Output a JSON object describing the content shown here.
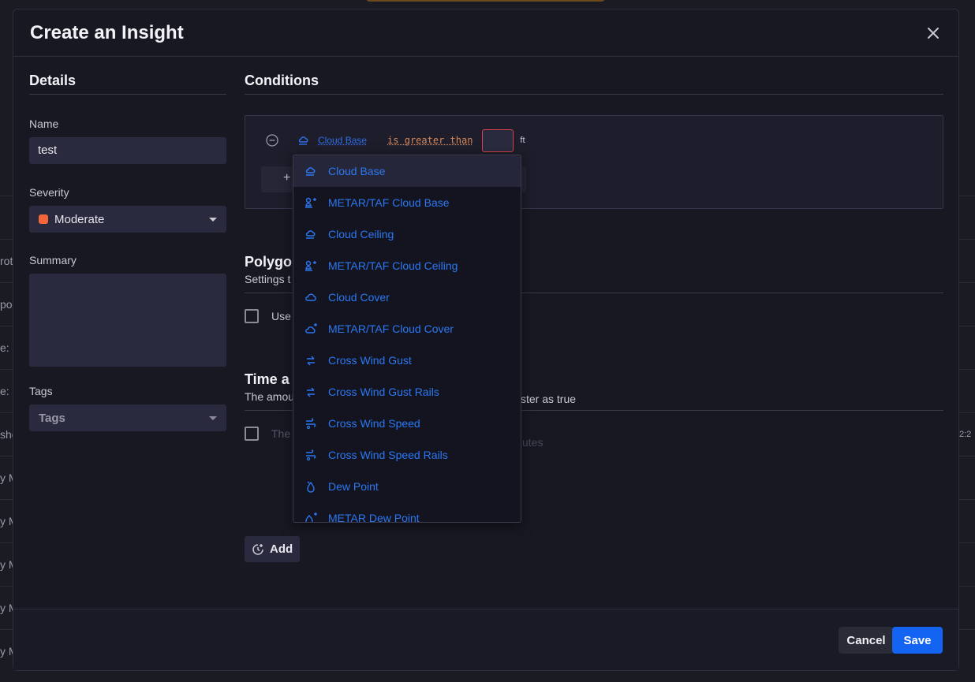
{
  "background": {
    "left_fragments": [
      "rot",
      "por",
      "e: ",
      "e: ",
      "sho",
      "y M",
      "y M",
      "y M",
      "y M",
      "y M"
    ],
    "right_fragment": "2:2"
  },
  "modal": {
    "title": "Create an Insight"
  },
  "details": {
    "title": "Details",
    "name_label": "Name",
    "name_value": "test",
    "severity_label": "Severity",
    "severity_value": "Moderate",
    "severity_color": "#f2663a",
    "summary_label": "Summary",
    "summary_value": "",
    "tags_label": "Tags",
    "tags_placeholder": "Tags"
  },
  "conditions": {
    "title": "Conditions",
    "metric": "Cloud Base",
    "operator": "is greater than",
    "value": "",
    "unit": "ft",
    "add_label": "+"
  },
  "polygon": {
    "title": "Polygo",
    "subtitle": "Settings t",
    "checkbox_label": "Use"
  },
  "time": {
    "title": "Time a",
    "subtitle_left": "The amou",
    "subtitle_right": "ster as true",
    "checkbox_label": "The",
    "dim_select": "utes",
    "add_label": "Add"
  },
  "dropdown": {
    "items": [
      {
        "label": "Cloud Base",
        "icon": "cloud-base-icon",
        "active": true
      },
      {
        "label": "METAR/TAF Cloud Base",
        "icon": "metar-cloud-base-icon"
      },
      {
        "label": "Cloud Ceiling",
        "icon": "cloud-ceiling-icon"
      },
      {
        "label": "METAR/TAF Cloud Ceiling",
        "icon": "metar-cloud-ceiling-icon"
      },
      {
        "label": "Cloud Cover",
        "icon": "cloud-cover-icon"
      },
      {
        "label": "METAR/TAF Cloud Cover",
        "icon": "metar-cloud-cover-icon"
      },
      {
        "label": "Cross Wind Gust",
        "icon": "cross-wind-icon"
      },
      {
        "label": "Cross Wind Gust Rails",
        "icon": "cross-wind-icon"
      },
      {
        "label": "Cross Wind Speed",
        "icon": "wind-speed-icon"
      },
      {
        "label": "Cross Wind Speed Rails",
        "icon": "wind-speed-icon"
      },
      {
        "label": "Dew Point",
        "icon": "dew-point-icon"
      },
      {
        "label": "METAR Dew Point",
        "icon": "metar-dew-point-icon"
      }
    ]
  },
  "footer": {
    "cancel_label": "Cancel",
    "save_label": "Save"
  },
  "colors": {
    "accent": "#1464f4",
    "link": "#2b78f2",
    "operator": "#d98a5a",
    "error_border": "#d9434a"
  }
}
